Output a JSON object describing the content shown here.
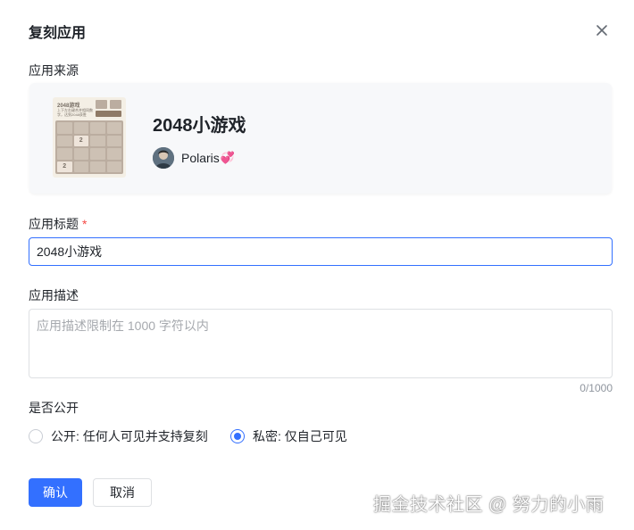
{
  "dialog": {
    "title": "复刻应用",
    "close_icon": "close-icon"
  },
  "source": {
    "label": "应用来源",
    "app_name": "2048小游戏",
    "author": "Polaris",
    "author_emoji": "💞",
    "thumbnail": {
      "title": "2048游戏",
      "subtitle": "上下左右键合并相同数字，达到2048获胜",
      "scores": [
        "0",
        "0"
      ],
      "grid": [
        "",
        "",
        "",
        "",
        "",
        "2",
        "",
        "",
        "",
        "",
        "",
        "",
        "2",
        "",
        "",
        ""
      ]
    }
  },
  "app_title": {
    "label": "应用标题",
    "required_mark": "*",
    "value": "2048小游戏"
  },
  "description": {
    "label": "应用描述",
    "placeholder": "应用描述限制在 1000 字符以内",
    "counter": "0/1000"
  },
  "visibility": {
    "label": "是否公开",
    "options": [
      {
        "label": "公开: 任何人可见并支持复刻",
        "checked": false
      },
      {
        "label": "私密: 仅自己可见",
        "checked": true
      }
    ]
  },
  "actions": {
    "confirm": "确认",
    "cancel": "取消"
  },
  "watermark": "掘金技术社区 @ 努力的小雨",
  "colors": {
    "primary": "#3370ff",
    "required": "#f54a45",
    "text": "#1f2329",
    "placeholder": "#a6a9ae"
  }
}
